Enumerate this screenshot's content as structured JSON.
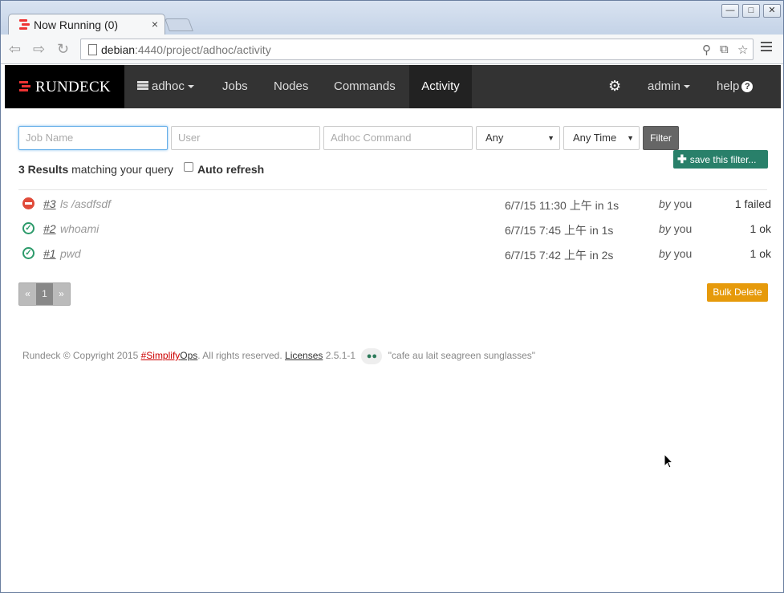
{
  "browser": {
    "tab_title": "Now Running (0)",
    "tab_close": "×",
    "url_host": "debian",
    "url_path": ":4440/project/adhoc/activity",
    "window_buttons": [
      "—",
      "□",
      "✕"
    ]
  },
  "navbar": {
    "brand": "RUNDECK",
    "project": "adhoc",
    "items": [
      "Jobs",
      "Nodes",
      "Commands",
      "Activity"
    ],
    "active": "Activity",
    "user": "admin",
    "help": "help"
  },
  "filters": {
    "job_name_placeholder": "Job Name",
    "user_placeholder": "User",
    "command_placeholder": "Adhoc Command",
    "status_value": "Any",
    "time_value": "Any Time",
    "filter_label": "Filter",
    "save_label": "save this filter..."
  },
  "results": {
    "count": "3 Results",
    "suffix": "matching your query",
    "auto_refresh": "Auto refresh"
  },
  "rows": [
    {
      "id": "#3",
      "cmd": "ls /asdfsdf",
      "time": "6/7/15 11:30 上午 in 1s",
      "by": "by",
      "user": "you",
      "result": "1 failed",
      "status": "failed"
    },
    {
      "id": "#2",
      "cmd": "whoami",
      "time": "6/7/15 7:45 上午 in 1s",
      "by": "by",
      "user": "you",
      "result": "1 ok",
      "status": "ok"
    },
    {
      "id": "#1",
      "cmd": "pwd",
      "time": "6/7/15 7:42 上午 in 2s",
      "by": "by",
      "user": "you",
      "result": "1 ok",
      "status": "ok"
    }
  ],
  "pager": {
    "prev": "«",
    "current": "1",
    "next": "»"
  },
  "bulk_delete": "Bulk Delete",
  "footer": {
    "prefix": "Rundeck © Copyright 2015 ",
    "simplify": "#Simplify",
    "ops": "Ops",
    "rights": ". All rights reserved. ",
    "licenses": "Licenses",
    "version": " 2.5.1-1 ",
    "codename": "\"cafe au lait seagreen sunglasses\""
  },
  "colors": {
    "navbar": "#333333",
    "brand_red": "#ee3333",
    "save_green": "#29806a",
    "bulk_orange": "#e69a0b",
    "failed_red": "#e04b3a",
    "ok_green": "#2c9a6a"
  }
}
